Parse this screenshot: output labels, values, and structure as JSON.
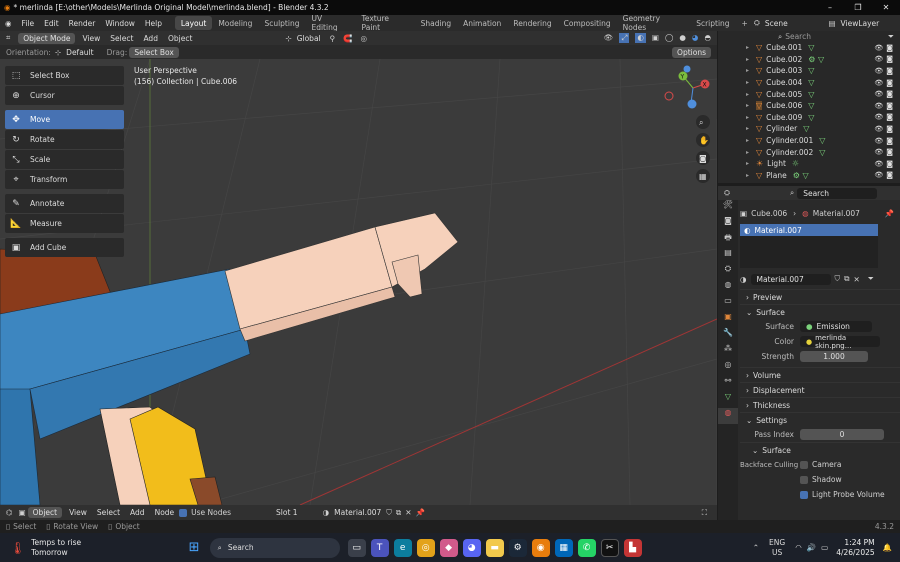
{
  "title": {
    "text": "* merlinda [E:\\other\\Models\\Merlinda Original Model\\merlinda.blend] - Blender 4.3.2",
    "minimize": "–",
    "maximize": "❐",
    "close": "✕"
  },
  "menu": {
    "items": [
      "File",
      "Edit",
      "Render",
      "Window",
      "Help"
    ]
  },
  "workspaces": [
    "Layout",
    "Modeling",
    "Sculpting",
    "UV Editing",
    "Texture Paint",
    "Shading",
    "Animation",
    "Rendering",
    "Compositing",
    "Geometry Nodes",
    "Scripting"
  ],
  "active_workspace": "Layout",
  "add_workspace": "+",
  "scene": {
    "label": "Scene",
    "view_layer": "ViewLayer"
  },
  "viewport_header": {
    "mode": "Object Mode",
    "menus": [
      "View",
      "Select",
      "Add",
      "Object"
    ],
    "transform": "Global",
    "orientation_label": "Orientation:",
    "orientation_value": "Default",
    "drag_label": "Drag:",
    "drag_value": "Select Box",
    "options": "Options"
  },
  "tools": [
    {
      "label": "Select Box",
      "icon": "⬚"
    },
    {
      "label": "Cursor",
      "icon": "⊕"
    },
    {
      "label": "Move",
      "icon": "✥"
    },
    {
      "label": "Rotate",
      "icon": "↻"
    },
    {
      "label": "Scale",
      "icon": "⤡"
    },
    {
      "label": "Transform",
      "icon": "⌖"
    },
    {
      "label": "Annotate",
      "icon": "✎"
    },
    {
      "label": "Measure",
      "icon": "📐"
    },
    {
      "label": "Add Cube",
      "icon": "▣"
    }
  ],
  "active_tool": "Move",
  "viewport_info": {
    "line1": "User Perspective",
    "line2": "(156) Collection | Cube.006"
  },
  "gizmo": {
    "x": "X",
    "y": "Y",
    "z": "Z"
  },
  "outliner": {
    "search_placeholder": "Search",
    "items": [
      {
        "name": "Cube.001",
        "icons": "▽"
      },
      {
        "name": "Cube.002",
        "icons": "⚙ ▽"
      },
      {
        "name": "Cube.003",
        "icons": "▽"
      },
      {
        "name": "Cube.004",
        "icons": "▽"
      },
      {
        "name": "Cube.005",
        "icons": "▽"
      },
      {
        "name": "Cube.006",
        "icons": "▽"
      },
      {
        "name": "Cube.009",
        "icons": "▽"
      },
      {
        "name": "Cylinder",
        "icons": "▽"
      },
      {
        "name": "Cylinder.001",
        "icons": "▽"
      },
      {
        "name": "Cylinder.002",
        "icons": "▽"
      },
      {
        "name": "Light",
        "icons": "☼"
      },
      {
        "name": "Plane",
        "icons": "⚙ ▽"
      }
    ]
  },
  "properties": {
    "search_placeholder": "Search",
    "breadcrumb_object": "Cube.006",
    "breadcrumb_material": "Material.007",
    "slot": "Material.007",
    "material_name": "Material.007",
    "sections": {
      "preview": "Preview",
      "surface": "Surface",
      "volume": "Volume",
      "displacement": "Displacement",
      "thickness": "Thickness",
      "settings": "Settings",
      "surface_sub": "Surface"
    },
    "surface_label": "Surface",
    "surface_value": "Emission",
    "color_label": "Color",
    "color_value": "merlinda skin.png...",
    "strength_label": "Strength",
    "strength_value": "1.000",
    "pass_index_label": "Pass Index",
    "pass_index_value": "0",
    "backface_label": "Backface Culling",
    "camera": "Camera",
    "shadow": "Shadow",
    "light_probe": "Light Probe Volume"
  },
  "bottom_header": {
    "editor": "Object",
    "menus": [
      "View",
      "Select",
      "Add",
      "Node"
    ],
    "use_nodes": "Use Nodes",
    "slot": "Slot 1",
    "material": "Material.007"
  },
  "status": {
    "select": "Select",
    "rotate": "Rotate View",
    "object": "Object",
    "version": "4.3.2"
  },
  "taskbar": {
    "weather_line1": "Temps to rise",
    "weather_line2": "Tomorrow",
    "search": "Search",
    "lang1": "ENG",
    "lang2": "US",
    "time": "1:24 PM",
    "date": "4/26/2025"
  },
  "colors": {
    "accent": "#4772b3",
    "viewport_bg": "#3b3b3b",
    "skin": "#f6d1bb",
    "blue": "#3d86c0",
    "yellow": "#f2bd1b"
  }
}
